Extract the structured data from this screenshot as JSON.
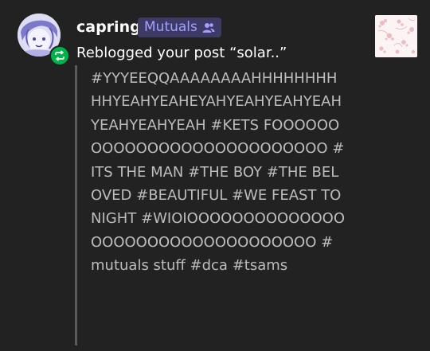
{
  "notification": {
    "username": "capring",
    "badge_label": "Mutuals",
    "badge_icon": "people-icon",
    "action_text": "Reblogged your post",
    "post_title": "“solar..”",
    "avatar_icon": "avatar-face-icon",
    "reblog_icon": "reblog-icon",
    "thumbnail_icon": "post-thumbnail",
    "colors": {
      "background": "#222222",
      "badge_bg": "#3e3a66",
      "badge_text": "#a59dff",
      "reblog_green": "#00b24a",
      "tag_text": "#bdbdbd"
    }
  },
  "tags": [
    "#YYYEEQQAAAAAAAAHHHHHHHHHHYEAHYEAHEYAHYEAHYEAHYEAHYEAHYEAHYEAH",
    "#KETS",
    "FOOOOOOOOOOOOOOOOOOOOOOOOOOO",
    "#ITS THE MAN",
    "#THE BOY",
    "#THE BELOVED",
    "#BEAUTIFUL",
    "#WE FEAST TONIGHT",
    "#WIOIOOOOOOOOOOOOOOOOOOOOOOOOOOOOOOOOOO",
    "#mutuals stuff",
    "#dca",
    "#tsams"
  ]
}
